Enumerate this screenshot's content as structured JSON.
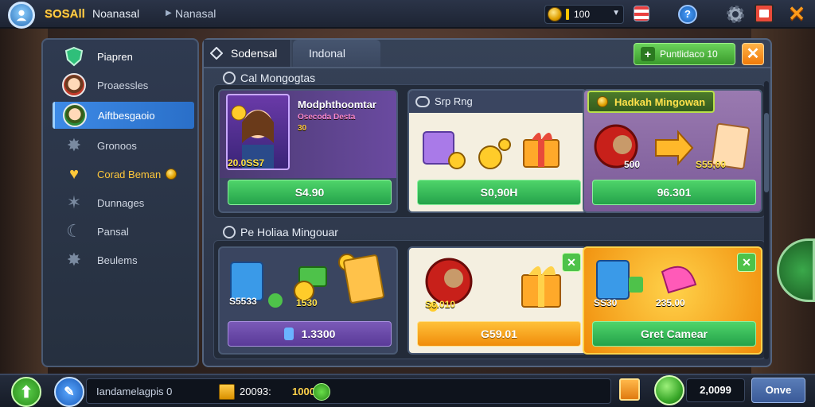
{
  "header": {
    "brand": "SOSAll",
    "brand_sub": "Noanasal",
    "breadcrumb": "Nanasal",
    "coins": "100",
    "help_label": "?"
  },
  "sidebar": {
    "items": [
      {
        "label": "Piapren",
        "icon": "shield-icon"
      },
      {
        "label": "Proaessles",
        "icon": "avatar-icon"
      },
      {
        "label": "Aiftbesgaoio",
        "icon": "avatar-icon"
      },
      {
        "label": "Gronoos",
        "icon": "star-icon"
      },
      {
        "label": "Corad Beman",
        "icon": "heart-icon"
      },
      {
        "label": "Dunnages",
        "icon": "star-icon"
      },
      {
        "label": "Pansal",
        "icon": "moon-icon"
      },
      {
        "label": "Beulems",
        "icon": "star-icon"
      }
    ]
  },
  "main": {
    "tabs": [
      {
        "label": "Sodensal"
      },
      {
        "label": "Indonal"
      }
    ],
    "cta_label": "Puntlidaco 10",
    "section1_title": "Cal Mongogtas",
    "section2_title": "Pe Holiaa Mingouar",
    "cards_row1": [
      {
        "title": "Modphthoomtar",
        "subtitle": "Osecoda Desta",
        "subtitle2": "30",
        "badge": "20.0SS7",
        "price": "S4.90"
      },
      {
        "title": "Srp Rng",
        "price": "S0,90H"
      },
      {
        "title": "Hadkah Mingowan",
        "label_left": "500",
        "label_right": "S55,00",
        "price": "96.301"
      }
    ],
    "cards_row2": [
      {
        "label_left": "S5533",
        "label_right": "1530",
        "price": "1.3300"
      },
      {
        "label_left": "S6.010",
        "price": "G59.01"
      },
      {
        "label_left": "SS30",
        "label_right": "235.00",
        "price": "Gret Camear"
      }
    ]
  },
  "bottombar": {
    "chat_text": "Iandamelagpis 0",
    "chat_amount": "20093:",
    "chat_amount2": "1000",
    "balance": "2,0099",
    "done_label": "Onve"
  },
  "colors": {
    "accent_blue": "#2a6fc8",
    "green_button": "#24a24a",
    "orange_button": "#f08c0a",
    "purple_button": "#5a3a98",
    "gold": "#ffc83a"
  }
}
